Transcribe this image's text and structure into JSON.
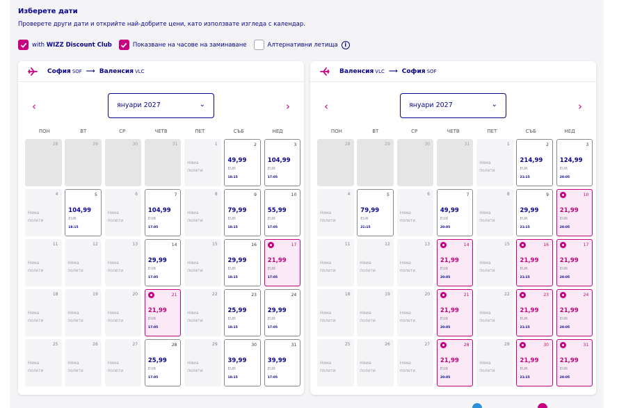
{
  "header": {
    "title": "Изберете дати",
    "subtitle": "Проверете други дати и открийте най-добрите цени, като използвате изгледа с календар."
  },
  "options": {
    "discount_prefix": "with ",
    "discount_bold": "WIZZ Discount Club",
    "show_times": "Показване на часове на заминаване",
    "alt_airports": "Алтернативни летища",
    "info_glyph": "i"
  },
  "colors": {
    "accent": "#c6007e",
    "brand": "#06038d"
  },
  "weekdays": [
    "ПОН",
    "ВТ",
    "СР",
    "ЧЕТВ",
    "ПЕТ",
    "СЪБ",
    "НЕД"
  ],
  "no_flight_l1": "Няма",
  "no_flight_l2": "полети",
  "currency": "EUR",
  "prev_glyph": "‹",
  "next_glyph": "›",
  "chevron_glyph": "⌄",
  "arrow_glyph": "⟶",
  "panels": [
    {
      "from_city": "София",
      "from_code": "SOF",
      "to_city": "Валенсия",
      "to_code": "VLC",
      "icon": "plane-takeoff-icon",
      "month": "януари 2027",
      "days": [
        {
          "d": "28",
          "t": "prev"
        },
        {
          "d": "29",
          "t": "prev"
        },
        {
          "d": "30",
          "t": "prev"
        },
        {
          "d": "31",
          "t": "prev"
        },
        {
          "d": "1",
          "t": "none"
        },
        {
          "d": "2",
          "t": "fl",
          "p": "49,99",
          "tm": "18:15"
        },
        {
          "d": "3",
          "t": "fl",
          "p": "104,99",
          "tm": "17:05"
        },
        {
          "d": "4",
          "t": "none"
        },
        {
          "d": "5",
          "t": "fl",
          "p": "104,99",
          "tm": "18:15"
        },
        {
          "d": "6",
          "t": "none"
        },
        {
          "d": "7",
          "t": "fl",
          "p": "104,99",
          "tm": "17:05"
        },
        {
          "d": "8",
          "t": "none"
        },
        {
          "d": "9",
          "t": "fl",
          "p": "79,99",
          "tm": "18:15"
        },
        {
          "d": "10",
          "t": "fl",
          "p": "55,99",
          "tm": "17:05"
        },
        {
          "d": "11",
          "t": "none"
        },
        {
          "d": "12",
          "t": "none"
        },
        {
          "d": "13",
          "t": "none"
        },
        {
          "d": "14",
          "t": "fl",
          "p": "29,99",
          "tm": "17:05"
        },
        {
          "d": "15",
          "t": "none"
        },
        {
          "d": "16",
          "t": "fl",
          "p": "29,99",
          "tm": "18:15"
        },
        {
          "d": "17",
          "t": "hl",
          "p": "21,99",
          "tm": "17:05"
        },
        {
          "d": "18",
          "t": "none"
        },
        {
          "d": "19",
          "t": "none"
        },
        {
          "d": "20",
          "t": "none"
        },
        {
          "d": "21",
          "t": "hl",
          "p": "21,99",
          "tm": "17:05"
        },
        {
          "d": "22",
          "t": "none"
        },
        {
          "d": "23",
          "t": "fl",
          "p": "25,99",
          "tm": "18:15"
        },
        {
          "d": "24",
          "t": "fl",
          "p": "29,99",
          "tm": "17:05"
        },
        {
          "d": "25",
          "t": "none"
        },
        {
          "d": "26",
          "t": "none"
        },
        {
          "d": "27",
          "t": "none"
        },
        {
          "d": "28",
          "t": "fl",
          "p": "25,99",
          "tm": "17:05"
        },
        {
          "d": "29",
          "t": "none"
        },
        {
          "d": "30",
          "t": "fl",
          "p": "39,99",
          "tm": "18:15"
        },
        {
          "d": "31",
          "t": "fl",
          "p": "39,99",
          "tm": "17:05"
        }
      ]
    },
    {
      "from_city": "Валенсия",
      "from_code": "VLC",
      "to_city": "София",
      "to_code": "SOF",
      "icon": "plane-landing-icon",
      "month": "януари 2027",
      "days": [
        {
          "d": "28",
          "t": "prev"
        },
        {
          "d": "29",
          "t": "prev"
        },
        {
          "d": "30",
          "t": "prev"
        },
        {
          "d": "31",
          "t": "prev"
        },
        {
          "d": "1",
          "t": "none"
        },
        {
          "d": "2",
          "t": "fl",
          "p": "214,99",
          "tm": "21:15"
        },
        {
          "d": "3",
          "t": "fl",
          "p": "124,99",
          "tm": "20:05"
        },
        {
          "d": "4",
          "t": "none"
        },
        {
          "d": "5",
          "t": "fl",
          "p": "79,99",
          "tm": "21:15"
        },
        {
          "d": "6",
          "t": "none"
        },
        {
          "d": "7",
          "t": "fl",
          "p": "49,99",
          "tm": "20:05"
        },
        {
          "d": "8",
          "t": "none"
        },
        {
          "d": "9",
          "t": "fl",
          "p": "29,99",
          "tm": "21:15"
        },
        {
          "d": "10",
          "t": "hl",
          "p": "21,99",
          "tm": "20:05"
        },
        {
          "d": "11",
          "t": "none"
        },
        {
          "d": "12",
          "t": "none"
        },
        {
          "d": "13",
          "t": "none"
        },
        {
          "d": "14",
          "t": "hl",
          "p": "21,99",
          "tm": "20:05"
        },
        {
          "d": "15",
          "t": "none"
        },
        {
          "d": "16",
          "t": "hl",
          "p": "21,99",
          "tm": "21:15"
        },
        {
          "d": "17",
          "t": "hl",
          "p": "21,99",
          "tm": "20:05"
        },
        {
          "d": "18",
          "t": "none"
        },
        {
          "d": "19",
          "t": "none"
        },
        {
          "d": "20",
          "t": "none"
        },
        {
          "d": "21",
          "t": "hl",
          "p": "21,99",
          "tm": "20:05"
        },
        {
          "d": "22",
          "t": "none"
        },
        {
          "d": "23",
          "t": "hl",
          "p": "21,99",
          "tm": "21:15"
        },
        {
          "d": "24",
          "t": "hl",
          "p": "21,99",
          "tm": "20:05"
        },
        {
          "d": "25",
          "t": "none"
        },
        {
          "d": "26",
          "t": "none"
        },
        {
          "d": "27",
          "t": "none"
        },
        {
          "d": "28",
          "t": "hl",
          "p": "21,99",
          "tm": "20:05"
        },
        {
          "d": "29",
          "t": "none"
        },
        {
          "d": "30",
          "t": "hl",
          "p": "21,99",
          "tm": "21:15"
        },
        {
          "d": "31",
          "t": "hl",
          "p": "21,99",
          "tm": "20:05"
        }
      ]
    }
  ]
}
